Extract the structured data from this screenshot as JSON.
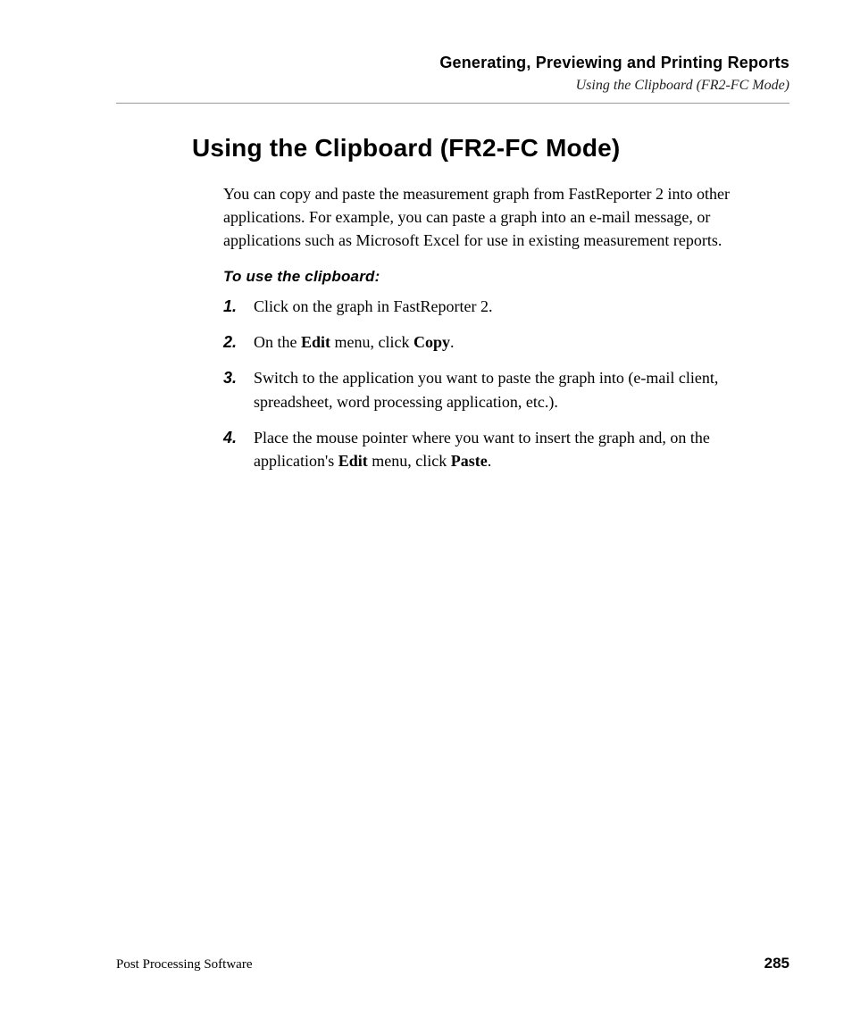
{
  "header": {
    "chapter_title": "Generating, Previewing and Printing Reports",
    "section_ref": "Using the Clipboard (FR2-FC Mode)"
  },
  "section": {
    "heading": "Using the Clipboard (FR2-FC Mode)",
    "intro": "You can copy and paste the measurement graph from FastReporter 2 into other applications. For example, you can paste a graph into an e-mail message, or applications such as Microsoft Excel for use in existing measurement reports.",
    "subheading": "To use the clipboard:",
    "steps": [
      {
        "num": "1.",
        "text": "Click on the graph in FastReporter 2."
      },
      {
        "num": "2.",
        "pre": "On the ",
        "b1": "Edit",
        "mid": " menu, click ",
        "b2": "Copy",
        "post": "."
      },
      {
        "num": "3.",
        "text": "Switch to the application you want to paste the graph into (e-mail client, spreadsheet, word processing application, etc.)."
      },
      {
        "num": "4.",
        "pre": "Place the mouse pointer where you want to insert the graph and, on the application's ",
        "b1": "Edit",
        "mid": " menu, click ",
        "b2": "Paste",
        "post": "."
      }
    ]
  },
  "footer": {
    "left": "Post Processing Software",
    "page_number": "285"
  }
}
